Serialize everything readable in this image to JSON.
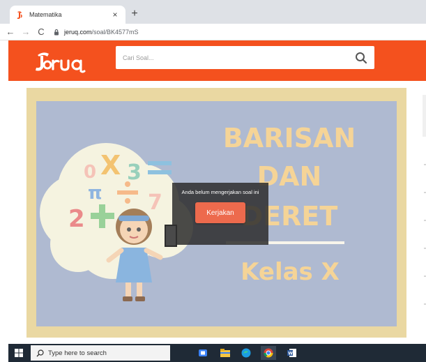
{
  "browser": {
    "tab": {
      "title": "Matematika",
      "close_glyph": "×",
      "favicon": "jeruq-favicon"
    },
    "new_tab_glyph": "+",
    "nav": {
      "back": "←",
      "forward": "→",
      "reload": "C"
    },
    "address": {
      "host": "jeruq.com",
      "path": "/soal/BK4577mS"
    }
  },
  "site": {
    "logo_text": "Jeruq",
    "search": {
      "placeholder": "Cari Soal...",
      "value": "",
      "icon": "search-icon"
    }
  },
  "slide": {
    "title_lines": [
      "BARISAN",
      "DAN",
      "DERET"
    ],
    "subtitle": "Kelas X"
  },
  "modal": {
    "message": "Anda belum mengerjakan soal ini",
    "button_label": "Kerjakan"
  },
  "taskbar": {
    "search_placeholder": "Type here to search",
    "apps": [
      "task-view-icon",
      "file-explorer-icon",
      "edge-icon",
      "chrome-icon",
      "word-icon"
    ]
  },
  "colors": {
    "brand": "#f4511e",
    "modal_button": "#ed6a4d",
    "board": "#99a7c4",
    "frame": "#e4cd88",
    "slide_text": "#f3c87a",
    "taskbar": "#1f2a36"
  }
}
